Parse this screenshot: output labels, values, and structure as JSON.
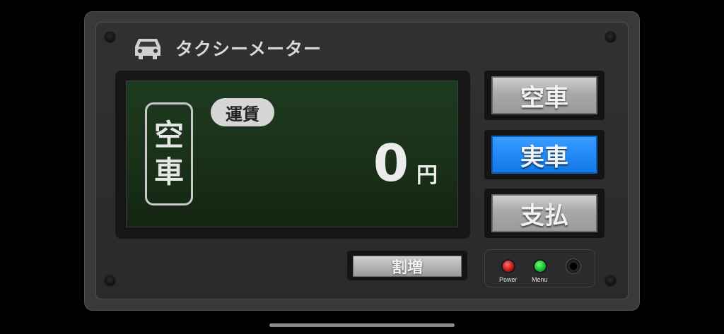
{
  "app": {
    "title": "タクシーメーター"
  },
  "display": {
    "status_chars": [
      "空",
      "車"
    ],
    "fare_badge": "運賃",
    "fare_value": "0",
    "fare_unit": "円"
  },
  "buttons": {
    "vacant": "空車",
    "occupied": "実車",
    "payment": "支払",
    "surcharge": "割増",
    "active": "occupied"
  },
  "controls": {
    "power_label": "Power",
    "menu_label": "Menu"
  },
  "colors": {
    "accent_blue": "#1f86f4",
    "lcd_green": "#1a3119",
    "power_led": "#c21515",
    "menu_led": "#14b82b"
  },
  "icons": {
    "title": "car-icon",
    "jack": "headphone-jack-icon"
  }
}
